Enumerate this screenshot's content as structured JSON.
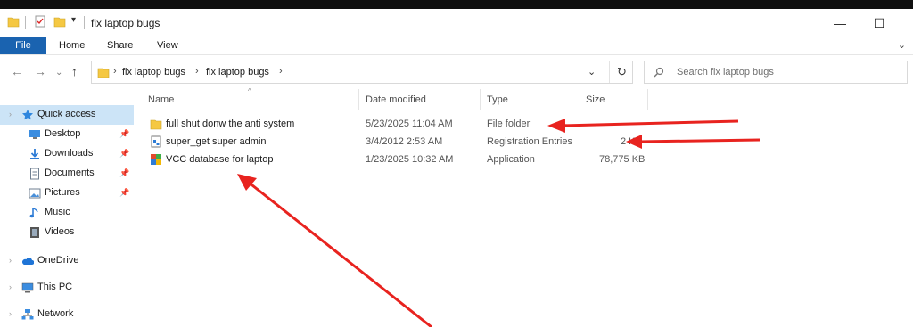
{
  "window": {
    "title": "fix laptop bugs",
    "minimize": "—",
    "maximize": "☐"
  },
  "ribbon": {
    "tabs": [
      "File",
      "Home",
      "Share",
      "View"
    ],
    "expand": "⌄"
  },
  "address": {
    "back": "←",
    "forward": "→",
    "recent": "⌄",
    "up": "↑",
    "sep": "›",
    "crumbs": [
      "fix laptop bugs",
      "fix laptop bugs"
    ],
    "dropdown": "⌄",
    "refresh": "↻"
  },
  "search": {
    "placeholder": "Search fix laptop bugs"
  },
  "navpane": {
    "items": [
      {
        "label": "Quick access",
        "icon": "star-icon",
        "selected": true
      },
      {
        "label": "Desktop",
        "icon": "desktop-icon",
        "pinned": true
      },
      {
        "label": "Downloads",
        "icon": "downloads-icon",
        "pinned": true
      },
      {
        "label": "Documents",
        "icon": "documents-icon",
        "pinned": true
      },
      {
        "label": "Pictures",
        "icon": "pictures-icon",
        "pinned": true
      },
      {
        "label": "Music",
        "icon": "music-icon"
      },
      {
        "label": "Videos",
        "icon": "videos-icon"
      },
      {
        "label": "OneDrive",
        "icon": "onedrive-icon"
      },
      {
        "label": "This PC",
        "icon": "this-pc-icon"
      },
      {
        "label": "Network",
        "icon": "network-icon"
      }
    ],
    "pin_glyph": "📌"
  },
  "columns": {
    "name": "Name",
    "date": "Date modified",
    "type": "Type",
    "size": "Size",
    "sort_indicator": "^"
  },
  "files": [
    {
      "name": "full shut donw the anti system",
      "date": "5/23/2025 11:04 AM",
      "type": "File folder",
      "size": "",
      "icon": "folder-icon"
    },
    {
      "name": "super_get super admin",
      "date": "3/4/2012 2:53 AM",
      "type": "Registration Entries",
      "size": "2 K",
      "icon": "registry-file-icon"
    },
    {
      "name": "VCC database for laptop",
      "date": "1/23/2025 10:32 AM",
      "type": "Application",
      "size": "78,775 KB",
      "icon": "application-icon"
    }
  ],
  "colors": {
    "file_tab": "#1a63b0",
    "selection": "#cce4f7",
    "folder": "#f5c842",
    "annotation_arrow": "#e8231f"
  }
}
